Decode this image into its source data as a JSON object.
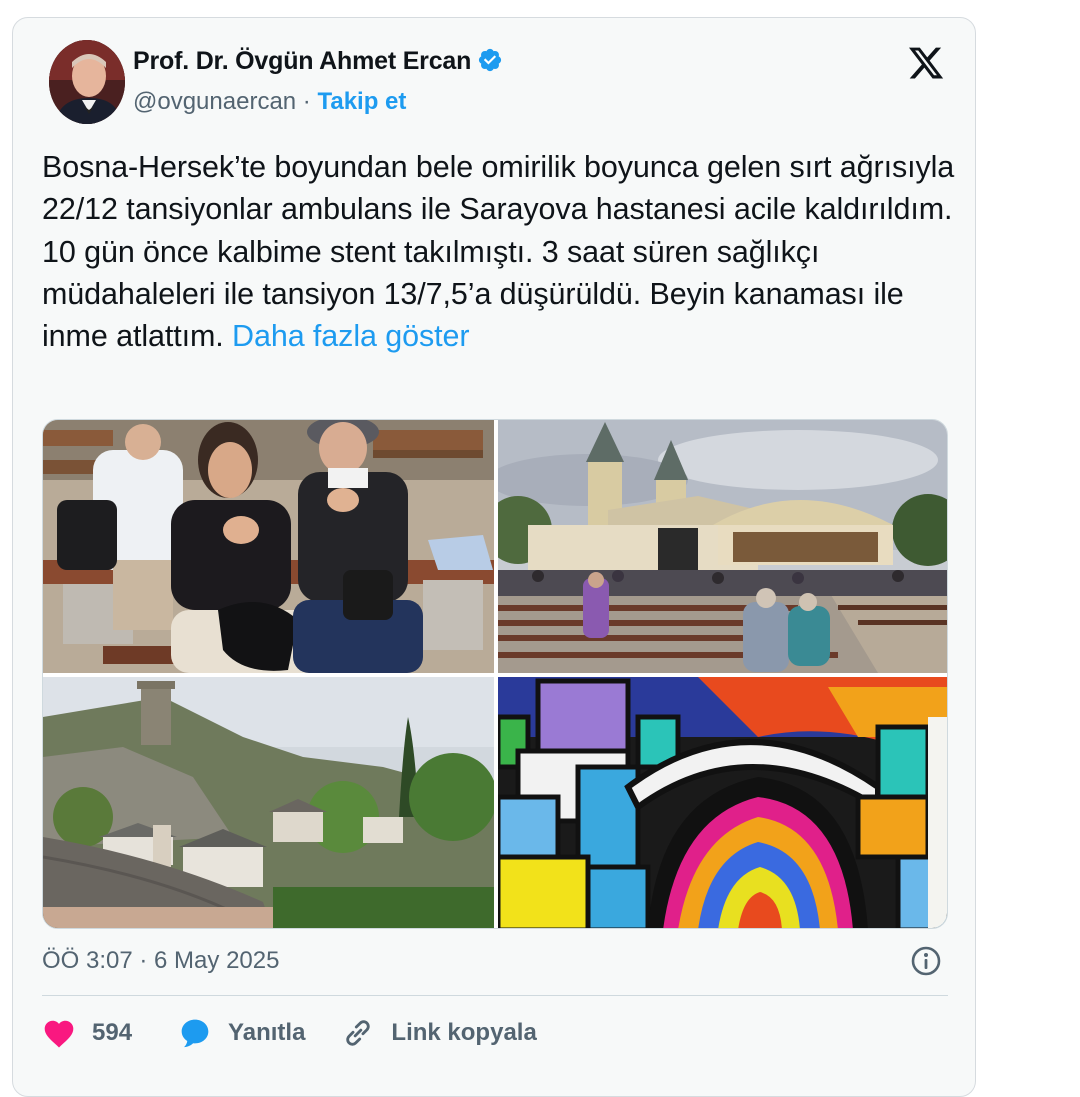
{
  "author": {
    "name": "Prof. Dr. Övgün Ahmet Ercan",
    "handle": "@ovgunaercan",
    "separator": " · ",
    "follow_label": "Takip et"
  },
  "tweet": {
    "text": "Bosna-Hersek’te boyundan bele omirilik boyunca gelen sırt ağrısıyla 22/12 tansiyonlar ambulans ile Sarayova hastanesi acile kaldırıldım. 10 gün  önce kalbime stent takılmıştı. 3 saat süren sağlıkçı müdahaleleri ile tansiyon 13/7,5’a düşürüldü. Beyin kanaması ile inme atlattım. ",
    "show_more_label": "Daha fazla göster",
    "timestamp": "ÖÖ 3:07 · 6 May 2025"
  },
  "actions": {
    "like_count": "594",
    "reply_label": "Yanıtla",
    "copy_link_label": "Link kopyala"
  },
  "icons": {
    "verified": "verified-badge-icon",
    "logo": "x-logo-icon",
    "info": "info-icon",
    "like": "heart-icon",
    "reply": "speech-bubble-icon",
    "link": "link-icon"
  },
  "colors": {
    "accent": "#1d9bf0",
    "like": "#f91880",
    "text": "#0f1419",
    "muted": "#536471",
    "card_bg": "#f7f9f9"
  }
}
